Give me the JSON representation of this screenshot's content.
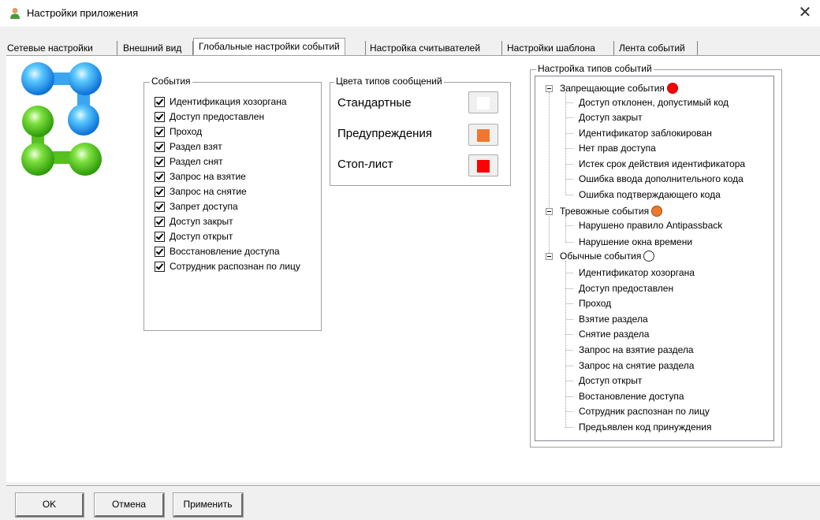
{
  "window": {
    "title": "Настройки приложения",
    "icon": "user-icon"
  },
  "tabs": [
    {
      "label": "Сетевые настройки"
    },
    {
      "label": "Внешний вид"
    },
    {
      "label": "Глобальные настройки событий",
      "active": true
    },
    {
      "label": "Настройка считывателей"
    },
    {
      "label": "Настройки шаблона"
    },
    {
      "label": "Лента событий"
    }
  ],
  "events_group": {
    "label": "События",
    "items": [
      {
        "label": "Идентификация хозоргана",
        "checked": true
      },
      {
        "label": "Доступ предоставлен",
        "checked": true
      },
      {
        "label": "Проход",
        "checked": true
      },
      {
        "label": "Раздел взят",
        "checked": true
      },
      {
        "label": "Раздел снят",
        "checked": true
      },
      {
        "label": "Запрос на взятие",
        "checked": true
      },
      {
        "label": "Запрос на снятие",
        "checked": true
      },
      {
        "label": "Запрет доступа",
        "checked": true
      },
      {
        "label": "Доступ закрыт",
        "checked": true
      },
      {
        "label": "Доступ открыт",
        "checked": true
      },
      {
        "label": "Восстановление доступа",
        "checked": true
      },
      {
        "label": "Сотрудник распознан по лицу",
        "checked": true
      }
    ]
  },
  "colors_group": {
    "label": "Цвета типов сообщений",
    "items": [
      {
        "label": "Стандартные",
        "color": "#ffffff"
      },
      {
        "label": "Предупреждения",
        "color": "#f0782e"
      },
      {
        "label": "Стоп-лист",
        "color": "#ff0000"
      }
    ]
  },
  "tree_group": {
    "label": "Настройка типов событий",
    "nodes": [
      {
        "label": "Запрещающие события",
        "color": "#ff0000",
        "children": [
          "Доступ отклонен, допустимый код",
          "Доступ закрыт",
          "Идентификатор заблокирован",
          "Нет прав доступа",
          "Истек срок действия идентификатора",
          "Ошибка ввода дополнительного кода",
          "Ошибка подтверждающего кода"
        ]
      },
      {
        "label": "Тревожные события",
        "color": "#f0782e",
        "children": [
          "Нарушено правило Antipassback",
          "Нарушение окна времени"
        ]
      },
      {
        "label": "Обычные события",
        "color": "#ffffff",
        "children": [
          "Идентификатор хозоргана",
          "Доступ предоставлен",
          "Проход",
          "Взятие раздела",
          "Снятие раздела",
          "Запрос на взятие раздела",
          "Запрос на снятие раздела",
          "Доступ открыт",
          "Востановление доступа",
          "Сотрудник распознан по лицу",
          "Предъявлен код принуждения"
        ]
      }
    ]
  },
  "buttons": {
    "ok": "OK",
    "cancel": "Отмена",
    "apply": "Применить"
  }
}
